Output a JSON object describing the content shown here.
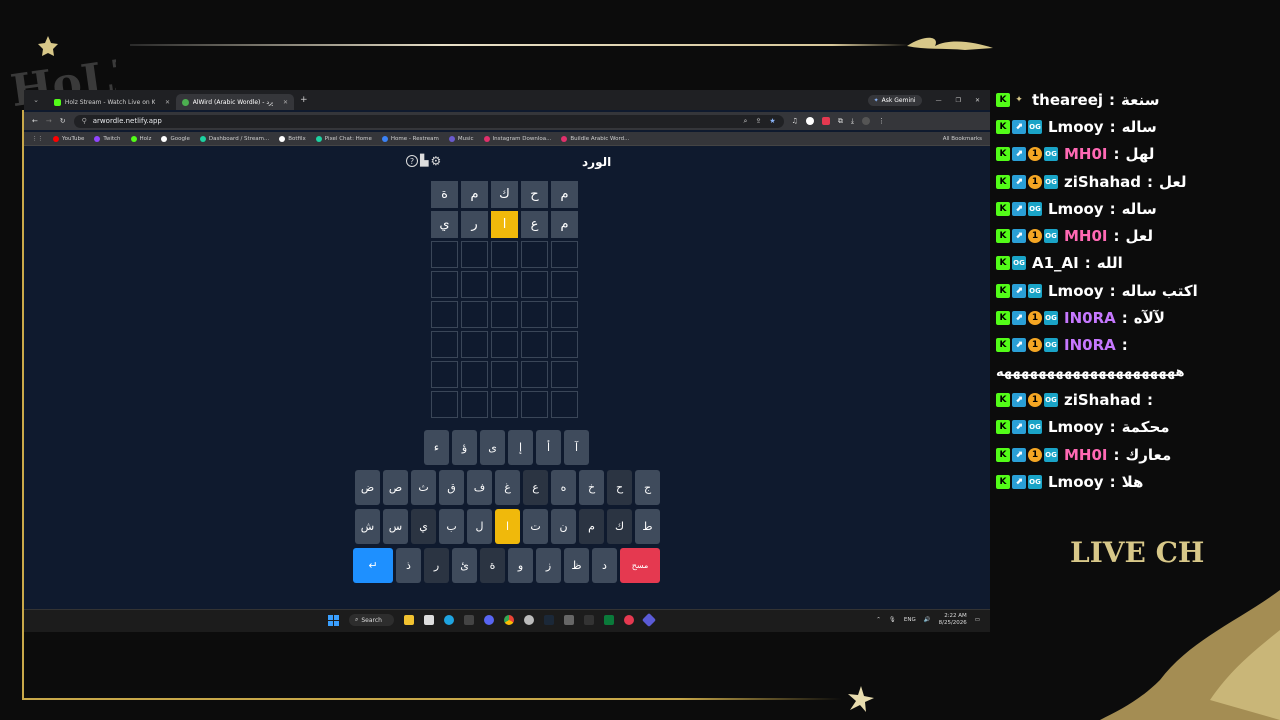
{
  "browser": {
    "tabs": [
      {
        "label": "Holz Stream - Watch Live on K",
        "favicon_color": "#53fc18"
      },
      {
        "label": "AlWird (Arabic Wordle) - الورد",
        "favicon_color": "#4caf50"
      }
    ],
    "new_tab_label": "+",
    "ask_gemini_label": "Ask Gemini",
    "url": "arwordle.netlify.app",
    "bookmarks": [
      {
        "label": "YouTube",
        "color": "#ff0000"
      },
      {
        "label": "Twitch",
        "color": "#9146ff"
      },
      {
        "label": "Holz",
        "color": "#53fc18"
      },
      {
        "label": "Google",
        "color": "#ffffff"
      },
      {
        "label": "Dashboard / Stream...",
        "color": "#1dd1a1"
      },
      {
        "label": "Botfilx",
        "color": "#ffffff"
      },
      {
        "label": "Pixel Chat: Home",
        "color": "#1dd1a1"
      },
      {
        "label": "Home - Restream",
        "color": "#3b82f6"
      },
      {
        "label": "Music",
        "color": "#6a5acd"
      },
      {
        "label": "Instagram Downloa...",
        "color": "#e1306c"
      },
      {
        "label": "Buildle Arabic Word...",
        "color": "#e1306c"
      }
    ],
    "all_bookmarks_label": "All Bookmarks"
  },
  "game": {
    "title": "الورد",
    "icons": [
      "help-icon",
      "stats-icon",
      "settings-icon"
    ],
    "icon_glyphs": {
      "help": "?",
      "stats": "▮",
      "settings": "⚙"
    },
    "rows": [
      [
        {
          "letter": "م",
          "state": "filled"
        },
        {
          "letter": "ح",
          "state": "filled"
        },
        {
          "letter": "ك",
          "state": "filled"
        },
        {
          "letter": "م",
          "state": "filled"
        },
        {
          "letter": "ة",
          "state": "filled"
        }
      ],
      [
        {
          "letter": "م",
          "state": "filled"
        },
        {
          "letter": "ع",
          "state": "filled"
        },
        {
          "letter": "ا",
          "state": "present"
        },
        {
          "letter": "ر",
          "state": "filled"
        },
        {
          "letter": "ي",
          "state": "filled"
        }
      ],
      [
        {
          "letter": "",
          "state": "empty"
        },
        {
          "letter": "",
          "state": "empty"
        },
        {
          "letter": "",
          "state": "empty"
        },
        {
          "letter": "",
          "state": "empty"
        },
        {
          "letter": "",
          "state": "empty"
        }
      ],
      [
        {
          "letter": "",
          "state": "empty"
        },
        {
          "letter": "",
          "state": "empty"
        },
        {
          "letter": "",
          "state": "empty"
        },
        {
          "letter": "",
          "state": "empty"
        },
        {
          "letter": "",
          "state": "empty"
        }
      ],
      [
        {
          "letter": "",
          "state": "empty"
        },
        {
          "letter": "",
          "state": "empty"
        },
        {
          "letter": "",
          "state": "empty"
        },
        {
          "letter": "",
          "state": "empty"
        },
        {
          "letter": "",
          "state": "empty"
        }
      ],
      [
        {
          "letter": "",
          "state": "empty"
        },
        {
          "letter": "",
          "state": "empty"
        },
        {
          "letter": "",
          "state": "empty"
        },
        {
          "letter": "",
          "state": "empty"
        },
        {
          "letter": "",
          "state": "empty"
        }
      ],
      [
        {
          "letter": "",
          "state": "empty"
        },
        {
          "letter": "",
          "state": "empty"
        },
        {
          "letter": "",
          "state": "empty"
        },
        {
          "letter": "",
          "state": "empty"
        },
        {
          "letter": "",
          "state": "empty"
        }
      ],
      [
        {
          "letter": "",
          "state": "empty"
        },
        {
          "letter": "",
          "state": "empty"
        },
        {
          "letter": "",
          "state": "empty"
        },
        {
          "letter": "",
          "state": "empty"
        },
        {
          "letter": "",
          "state": "empty"
        }
      ]
    ],
    "keyboard": [
      [
        {
          "k": "ء",
          "s": "normal"
        },
        {
          "k": "ؤ",
          "s": "normal"
        },
        {
          "k": "ى",
          "s": "normal"
        },
        {
          "k": "إ",
          "s": "normal"
        },
        {
          "k": "أ",
          "s": "normal"
        },
        {
          "k": "آ",
          "s": "normal"
        }
      ],
      [
        {
          "k": "ض",
          "s": "normal"
        },
        {
          "k": "ص",
          "s": "normal"
        },
        {
          "k": "ث",
          "s": "normal"
        },
        {
          "k": "ق",
          "s": "normal"
        },
        {
          "k": "ف",
          "s": "normal"
        },
        {
          "k": "غ",
          "s": "normal"
        },
        {
          "k": "ع",
          "s": "dark"
        },
        {
          "k": "ه",
          "s": "normal"
        },
        {
          "k": "خ",
          "s": "normal"
        },
        {
          "k": "ح",
          "s": "dark"
        },
        {
          "k": "ج",
          "s": "normal"
        }
      ],
      [
        {
          "k": "ش",
          "s": "normal"
        },
        {
          "k": "س",
          "s": "normal"
        },
        {
          "k": "ي",
          "s": "dark"
        },
        {
          "k": "ب",
          "s": "normal"
        },
        {
          "k": "ل",
          "s": "normal"
        },
        {
          "k": "ا",
          "s": "present"
        },
        {
          "k": "ت",
          "s": "normal"
        },
        {
          "k": "ن",
          "s": "normal"
        },
        {
          "k": "م",
          "s": "dark"
        },
        {
          "k": "ك",
          "s": "dark"
        },
        {
          "k": "ط",
          "s": "normal"
        }
      ],
      [
        {
          "k": "↵",
          "s": "enter"
        },
        {
          "k": "ذ",
          "s": "normal"
        },
        {
          "k": "ر",
          "s": "dark"
        },
        {
          "k": "ئ",
          "s": "normal"
        },
        {
          "k": "ة",
          "s": "dark"
        },
        {
          "k": "و",
          "s": "normal"
        },
        {
          "k": "ز",
          "s": "normal"
        },
        {
          "k": "ظ",
          "s": "normal"
        },
        {
          "k": "د",
          "s": "normal"
        },
        {
          "k": "مسح",
          "s": "del"
        }
      ]
    ]
  },
  "taskbar": {
    "search_label": "Search",
    "lang": "ENG",
    "time": "2:22 AM",
    "date": "8/25/2026"
  },
  "chat": {
    "messages": [
      {
        "user": "theareej",
        "text": "سنعة",
        "user_color": "#ffffff",
        "badges": [
          "k",
          "star"
        ]
      },
      {
        "user": "Lmooy",
        "text": "ساله",
        "user_color": "#ffffff",
        "badges": [
          "k",
          "sub",
          "og"
        ]
      },
      {
        "user": "MH0I",
        "text": "لهل",
        "user_color": "#ff69b4",
        "badges": [
          "k",
          "sub",
          "1",
          "og"
        ]
      },
      {
        "user": "ziShahad",
        "text": "لعل",
        "user_color": "#ffffff",
        "badges": [
          "k",
          "sub",
          "1",
          "og"
        ]
      },
      {
        "user": "Lmooy",
        "text": "ساله",
        "user_color": "#ffffff",
        "badges": [
          "k",
          "sub",
          "og"
        ]
      },
      {
        "user": "MH0I",
        "text": "لعل",
        "user_color": "#ff69b4",
        "badges": [
          "k",
          "sub",
          "1",
          "og"
        ]
      },
      {
        "user": "A1_AI",
        "text": "الله",
        "user_color": "#ffffff",
        "badges": [
          "k",
          "og"
        ]
      },
      {
        "user": "Lmooy",
        "text": "اكتب ساله",
        "user_color": "#ffffff",
        "badges": [
          "k",
          "sub",
          "og"
        ]
      },
      {
        "user": "IN0RA",
        "text": "لآلآه",
        "user_color": "#c678ff",
        "badges": [
          "k",
          "sub",
          "1",
          "og"
        ]
      },
      {
        "user": "IN0RA",
        "text": "",
        "user_color": "#c678ff",
        "badges": [
          "k",
          "sub",
          "1",
          "og"
        ]
      },
      {
        "user": "",
        "text": "هههههههههههههههههههههه",
        "user_color": "#ffffff",
        "badges": []
      },
      {
        "user": "ziShahad",
        "text": "",
        "user_color": "#ffffff",
        "badges": [
          "k",
          "sub",
          "1",
          "og"
        ]
      },
      {
        "user": "Lmooy",
        "text": "محكمة",
        "user_color": "#ffffff",
        "badges": [
          "k",
          "sub",
          "og"
        ]
      },
      {
        "user": "MH0I",
        "text": "معارك",
        "user_color": "#ff69b4",
        "badges": [
          "k",
          "sub",
          "1",
          "og"
        ]
      },
      {
        "user": "Lmooy",
        "text": "هلا",
        "user_color": "#ffffff",
        "badges": [
          "k",
          "sub",
          "og"
        ]
      }
    ],
    "separator": ":",
    "live_chat_label": "LIVE CH"
  },
  "colors": {
    "accent_gold": "#d8c889",
    "tile_present": "#f0b90b",
    "tile_filled": "#3f4b5c",
    "key_enter": "#1e90ff",
    "key_delete": "#e53950"
  }
}
